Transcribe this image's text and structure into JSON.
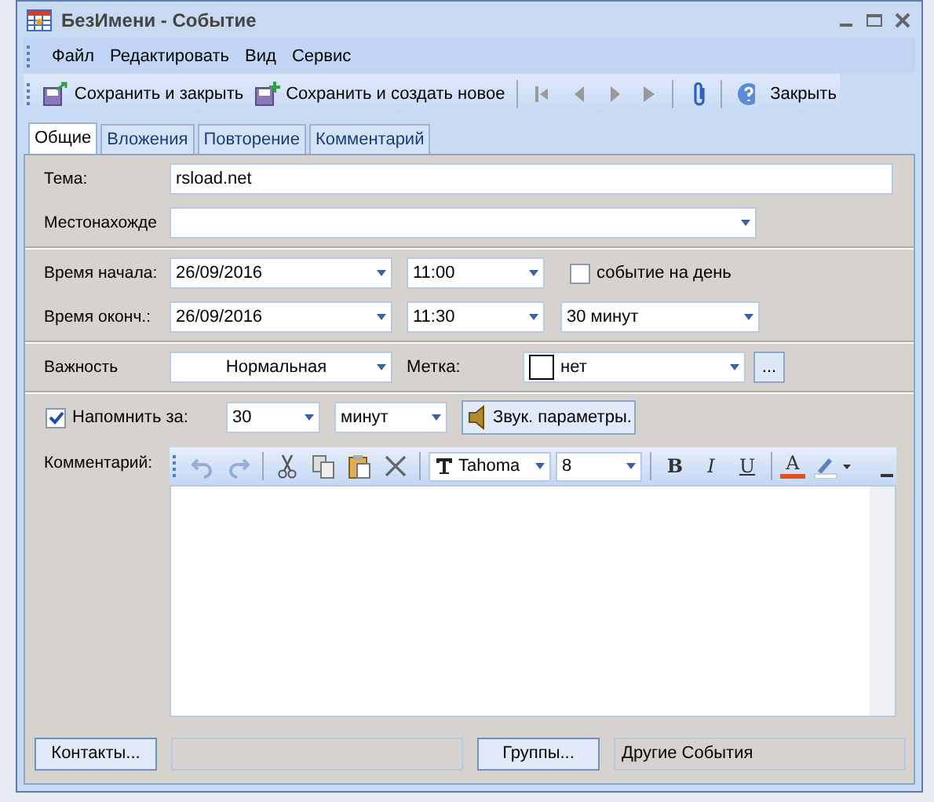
{
  "window": {
    "title": "БезИмени - Событие"
  },
  "menu": [
    "Файл",
    "Редактировать",
    "Вид",
    "Сервис"
  ],
  "toolbar": [
    {
      "kind": "save",
      "label": "Сохранить и закрыть"
    },
    {
      "kind": "save-new",
      "label": "Сохранить и создать новое"
    },
    {
      "kind": "first"
    },
    {
      "kind": "prev"
    },
    {
      "kind": "next"
    },
    {
      "kind": "last"
    },
    {
      "kind": "attach"
    },
    {
      "kind": "help"
    },
    {
      "kind": "text",
      "label": "Закрыть"
    }
  ],
  "tabs": [
    {
      "label": "Общие",
      "selected": true
    },
    {
      "label": "Вложения",
      "selected": false
    },
    {
      "label": "Повторение",
      "selected": false
    },
    {
      "label": "Комментарий",
      "selected": false
    }
  ],
  "subject": {
    "label": "Тема:",
    "value": "rsload.net"
  },
  "location": {
    "label": "Местонахожде"
  },
  "start": {
    "label": "Время начала:",
    "date": "26/09/2016",
    "time": "11:00",
    "all_day": {
      "label": "событие на день",
      "checked": false
    }
  },
  "end": {
    "label": "Время оконч.:",
    "date": "26/09/2016",
    "time": "11:30",
    "duration": "30 минут"
  },
  "importance": {
    "label": "Важность",
    "value": "Нормальная"
  },
  "tag": {
    "label": "Метка:",
    "value": "нет",
    "more": "..."
  },
  "reminder": {
    "label": "Напомнить за:",
    "checked": true,
    "amount": "30",
    "unit": "минут",
    "sound": "Звук. параметры."
  },
  "comment": {
    "label": "Комментарий:",
    "tools": [
      {
        "kind": "undo",
        "disabled": true
      },
      {
        "kind": "redo",
        "disabled": true
      },
      {
        "kind": "sep"
      },
      {
        "kind": "cut",
        "disabled": false
      },
      {
        "kind": "copy",
        "disabled": false
      },
      {
        "kind": "paste",
        "disabled": false
      },
      {
        "kind": "delete",
        "disabled": false
      },
      {
        "kind": "sep"
      },
      {
        "kind": "font",
        "value": "Tahoma"
      },
      {
        "kind": "size",
        "value": "8"
      },
      {
        "kind": "sep"
      },
      {
        "kind": "bold",
        "text": "B"
      },
      {
        "kind": "italic",
        "text": "I"
      },
      {
        "kind": "underline",
        "text": "U"
      },
      {
        "kind": "sep"
      },
      {
        "kind": "color",
        "text": "A"
      },
      {
        "kind": "highlight"
      }
    ]
  },
  "footer": {
    "contacts": "Контакты...",
    "groups": "Группы...",
    "groups_value": "Другие События"
  }
}
